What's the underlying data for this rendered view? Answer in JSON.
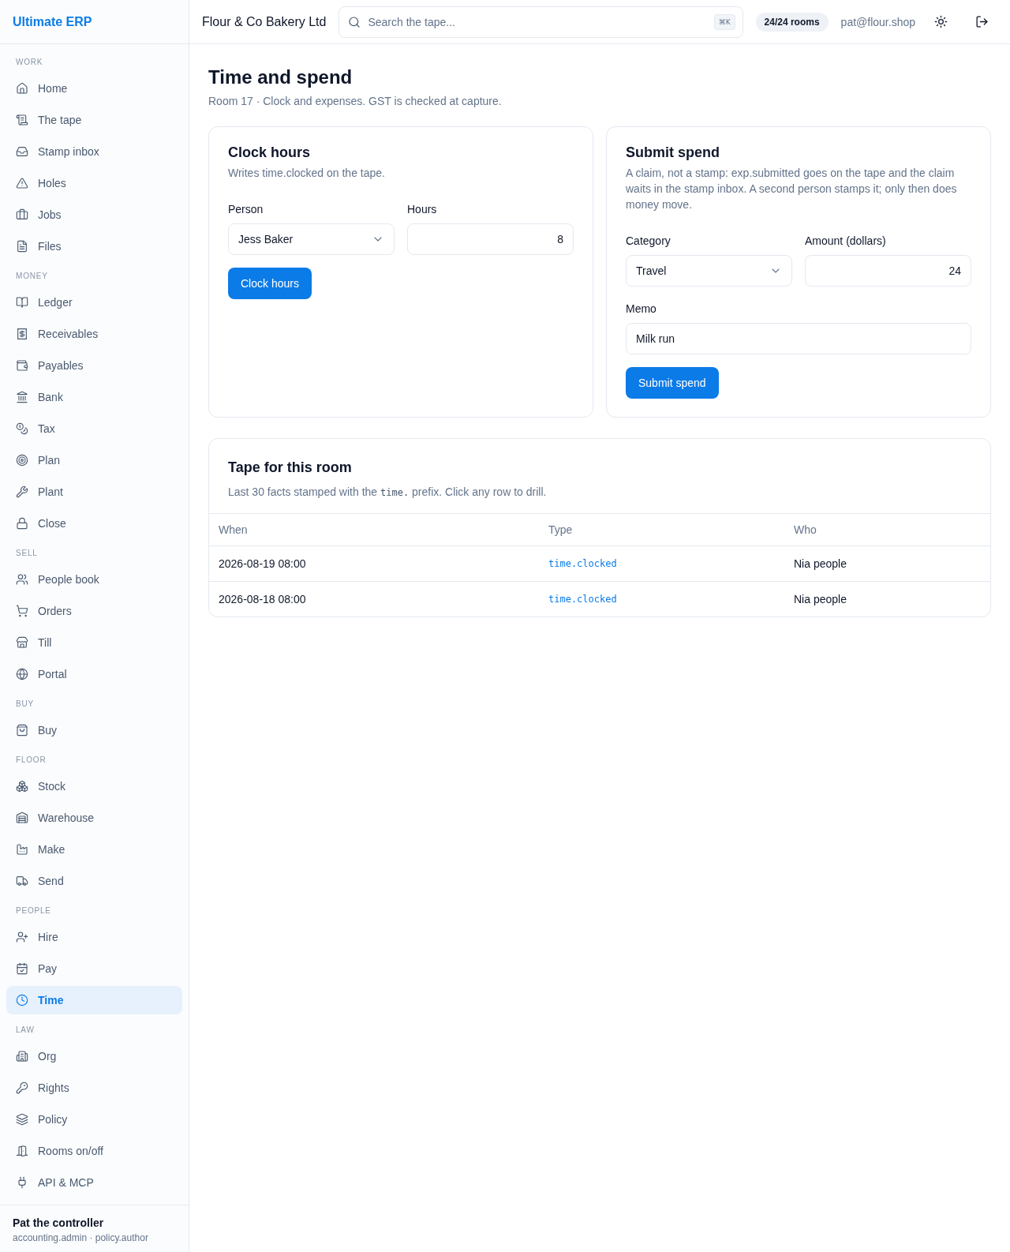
{
  "sidebar": {
    "brand": "Ultimate ERP",
    "sections": [
      {
        "label": "WORK",
        "items": [
          {
            "label": "Home",
            "selected": false
          },
          {
            "label": "The tape",
            "selected": false
          },
          {
            "label": "Stamp inbox",
            "selected": false
          },
          {
            "label": "Holes",
            "selected": false
          },
          {
            "label": "Jobs",
            "selected": false
          },
          {
            "label": "Files",
            "selected": false
          }
        ]
      },
      {
        "label": "MONEY",
        "items": [
          {
            "label": "Ledger",
            "selected": false
          },
          {
            "label": "Receivables",
            "selected": false
          },
          {
            "label": "Payables",
            "selected": false
          },
          {
            "label": "Bank",
            "selected": false
          },
          {
            "label": "Tax",
            "selected": false
          },
          {
            "label": "Plan",
            "selected": false
          },
          {
            "label": "Plant",
            "selected": false
          },
          {
            "label": "Close",
            "selected": false
          }
        ]
      },
      {
        "label": "SELL",
        "items": [
          {
            "label": "People book",
            "selected": false
          },
          {
            "label": "Orders",
            "selected": false
          },
          {
            "label": "Till",
            "selected": false
          },
          {
            "label": "Portal",
            "selected": false
          }
        ]
      },
      {
        "label": "BUY",
        "items": [
          {
            "label": "Buy",
            "selected": false
          }
        ]
      },
      {
        "label": "FLOOR",
        "items": [
          {
            "label": "Stock",
            "selected": false
          },
          {
            "label": "Warehouse",
            "selected": false
          },
          {
            "label": "Make",
            "selected": false
          },
          {
            "label": "Send",
            "selected": false
          }
        ]
      },
      {
        "label": "PEOPLE",
        "items": [
          {
            "label": "Hire",
            "selected": false
          },
          {
            "label": "Pay",
            "selected": false
          },
          {
            "label": "Time",
            "selected": true
          }
        ]
      },
      {
        "label": "LAW",
        "items": [
          {
            "label": "Org",
            "selected": false
          },
          {
            "label": "Rights",
            "selected": false
          },
          {
            "label": "Policy",
            "selected": false
          },
          {
            "label": "Rooms on/off",
            "selected": false
          },
          {
            "label": "API & MCP",
            "selected": false
          }
        ]
      }
    ],
    "user": {
      "name": "Pat the controller",
      "roles": "accounting.admin · policy.author"
    }
  },
  "topbar": {
    "company": "Flour & Co Bakery Ltd",
    "search": {
      "placeholder": "Search the tape...",
      "shortcut": "⌘K"
    },
    "rooms_badge": "24/24 rooms",
    "email": "pat@flour.shop"
  },
  "page": {
    "title": "Time and spend",
    "subtitle": "Room 17 · Clock and expenses. GST is checked at capture."
  },
  "clock_card": {
    "title": "Clock hours",
    "description": "Writes time.clocked on the tape.",
    "fields": [
      {
        "kind": "select",
        "label": "Person",
        "value": "Jess Baker"
      },
      {
        "kind": "number",
        "label": "Hours",
        "value": "8"
      }
    ],
    "button": "Clock hours"
  },
  "spend_card": {
    "title": "Submit spend",
    "description": "A claim, not a stamp: exp.submitted goes on the tape and the claim waits in the stamp inbox. A second person stamps it; only then does money move.",
    "fields": [
      {
        "kind": "select",
        "label": "Category",
        "value": "Travel"
      },
      {
        "kind": "number",
        "label": "Amount (dollars)",
        "value": "24"
      },
      {
        "kind": "text",
        "label": "Memo",
        "value": "Milk run"
      }
    ],
    "button": "Submit spend"
  },
  "tape_card": {
    "title": "Tape for this room",
    "description": [
      {
        "kind": "text",
        "text": "Last 30 facts stamped with the "
      },
      {
        "kind": "code",
        "text": "time."
      },
      {
        "kind": "text",
        "text": " prefix. Click any row to drill."
      }
    ],
    "table": {
      "columns": [
        "When",
        "Type",
        "Who"
      ],
      "rows": [
        [
          "2026-08-19 08:00",
          "time.clocked",
          "Nia people"
        ],
        [
          "2026-08-18 08:00",
          "time.clocked",
          "Nia people"
        ]
      ]
    }
  }
}
